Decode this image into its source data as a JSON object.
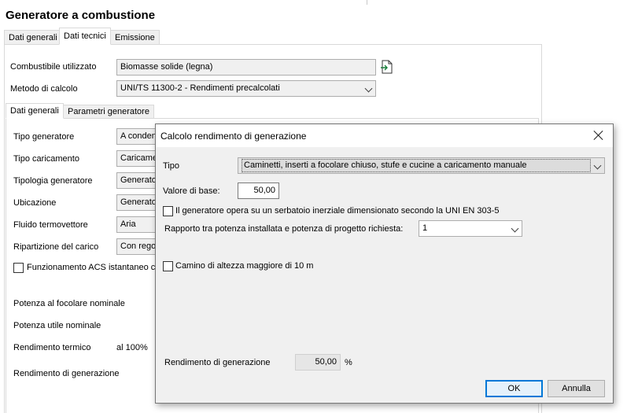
{
  "page": {
    "title": "Generatore a combustione"
  },
  "main_tabs": [
    {
      "label": "Dati generali"
    },
    {
      "label": "Dati tecnici"
    },
    {
      "label": "Emissione"
    }
  ],
  "fuel": {
    "label": "Combustibile utilizzato",
    "value": "Biomasse solide (legna)"
  },
  "method": {
    "label": "Metodo di calcolo",
    "value": "UNI/TS 11300-2 - Rendimenti precalcolati"
  },
  "sub_tabs": [
    {
      "label": "Dati generali"
    },
    {
      "label": "Parametri generatore"
    }
  ],
  "fields": {
    "tipo_generatore": {
      "label": "Tipo generatore",
      "value": "A condens"
    },
    "tipo_caricamento": {
      "label": "Tipo caricamento",
      "value": "Caricamen"
    },
    "tipologia_generatore": {
      "label": "Tipologia generatore",
      "value": "Generator"
    },
    "ubicazione": {
      "label": "Ubicazione",
      "value": "Generator"
    },
    "fluido": {
      "label": "Fluido termovettore",
      "value": "Aria"
    },
    "ripartizione": {
      "label": "Ripartizione del carico",
      "value": "Con regol"
    },
    "acs": {
      "label": "Funzionamento ACS istantaneo con"
    },
    "potenza_focolare": {
      "label": "Potenza al focolare nominale"
    },
    "potenza_utile": {
      "label": "Potenza utile nominale"
    },
    "rendimento_termico": {
      "label": "Rendimento termico",
      "suffix": "al 100%"
    },
    "rendimento_generazione": {
      "label": "Rendimento di generazione"
    }
  },
  "dialog": {
    "title": "Calcolo rendimento di generazione",
    "tipo_label": "Tipo",
    "tipo_value": "Caminetti, inserti a focolare chiuso, stufe e cucine a caricamento manuale",
    "valore_base_label": "Valore di base:",
    "valore_base_value": "50,00",
    "serbatoio_label": "Il generatore opera su un serbatoio inerziale dimensionato secondo la UNI EN 303-5",
    "rapporto_label": "Rapporto tra potenza installata e potenza di progetto richiesta:",
    "rapporto_value": "1",
    "camino_label": "Camino di altezza maggiore di 10 m",
    "rendimento_label": "Rendimento di generazione",
    "rendimento_value": "50,00",
    "rendimento_unit": "%",
    "ok_label": "OK",
    "cancel_label": "Annulla"
  }
}
